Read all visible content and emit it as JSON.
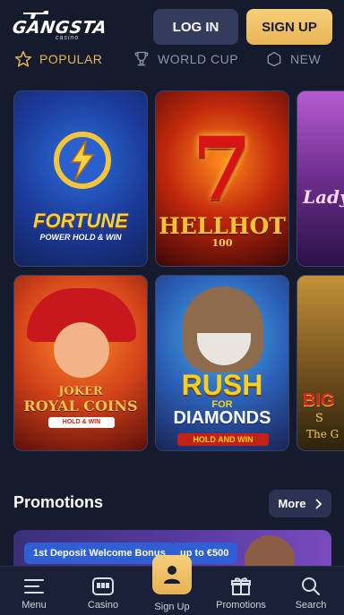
{
  "header": {
    "logo_main": "GANGSTA",
    "logo_sub": "casino",
    "login_label": "LOG IN",
    "signup_label": "SIGN UP"
  },
  "categories": [
    {
      "label": "POPULAR",
      "icon": "star-icon",
      "active": true
    },
    {
      "label": "WORLD CUP",
      "icon": "trophy-icon",
      "active": false
    },
    {
      "label": "NEW",
      "icon": "new-icon",
      "active": false
    }
  ],
  "games": [
    {
      "title": "FORTUNE",
      "subtitle": "POWER HOLD & WIN"
    },
    {
      "title": "HELLHOT",
      "subtitle": "100"
    },
    {
      "title": "Lady"
    },
    {
      "title_top": "JOKER",
      "title": "ROYAL COINS",
      "badge": "HOLD & WIN"
    },
    {
      "title": "RUSH",
      "for": "FOR",
      "title2": "DIAMONDS",
      "badge": "HOLD AND WIN"
    },
    {
      "title": "BIG",
      "sub": "S",
      "sub2": "The G"
    }
  ],
  "promotions": {
    "heading": "Promotions",
    "more_label": "More",
    "card": {
      "pill1": "1st Deposit Welcome Bonus",
      "pill2": "up to €500"
    }
  },
  "bottom_nav": [
    {
      "label": "Menu",
      "icon": "menu-icon"
    },
    {
      "label": "Casino",
      "icon": "slot-machine-icon"
    },
    {
      "label": "Sign Up",
      "icon": "user-icon"
    },
    {
      "label": "Promotions",
      "icon": "gift-icon"
    },
    {
      "label": "Search",
      "icon": "search-icon"
    }
  ],
  "colors": {
    "background": "#151a2d",
    "accent_gold": "#e7b45a",
    "login_button": "#343c5e",
    "pill_blue": "#2f5fd2"
  }
}
